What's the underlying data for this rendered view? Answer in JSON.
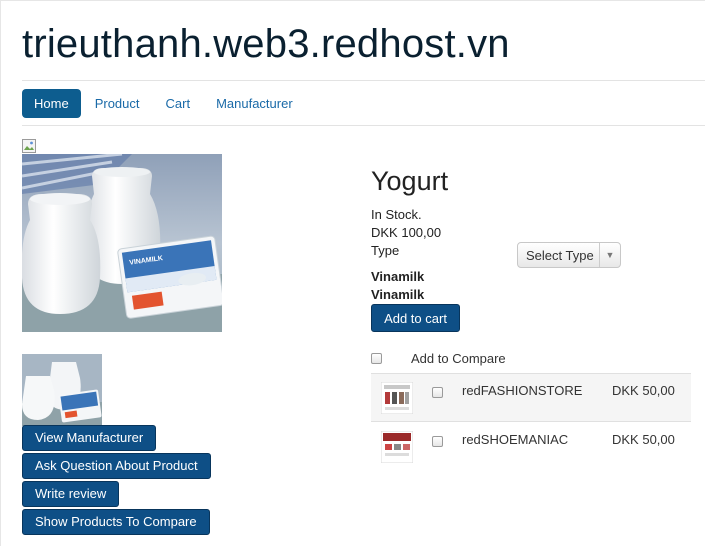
{
  "site": {
    "title": "trieuthanh.web3.redhost.vn"
  },
  "nav": [
    {
      "label": "Home",
      "active": true
    },
    {
      "label": "Product",
      "active": false
    },
    {
      "label": "Cart",
      "active": false
    },
    {
      "label": "Manufacturer",
      "active": false
    }
  ],
  "product": {
    "title": "Yogurt",
    "stock": "In Stock.",
    "price": "DKK 100,00",
    "type_label": "Type",
    "type_select": "Select Type",
    "manufacturer_1": "Vinamilk",
    "manufacturer_2": "Vinamilk",
    "add_to_cart": "Add to cart",
    "image_alt": "Vinamilk yogurt jars and cup",
    "brand_on_pack": "VINAMILK"
  },
  "actions": {
    "view_manufacturer": "View Manufacturer",
    "ask_question": "Ask Question About Product",
    "write_review": "Write review",
    "show_compare": "Show Products To Compare"
  },
  "compare": {
    "label": "Add to Compare",
    "items": [
      {
        "name": "redFASHIONSTORE",
        "price": "DKK 50,00",
        "thumb_icon": "fashion-store-thumbnail"
      },
      {
        "name": "redSHOEMANIAC",
        "price": "DKK 50,00",
        "thumb_icon": "shoe-maniac-thumbnail"
      }
    ]
  },
  "colors": {
    "primary": "#0e4f86",
    "nav_active": "#0d5d8f",
    "link": "#1a6aa8",
    "title": "#0a2030"
  }
}
